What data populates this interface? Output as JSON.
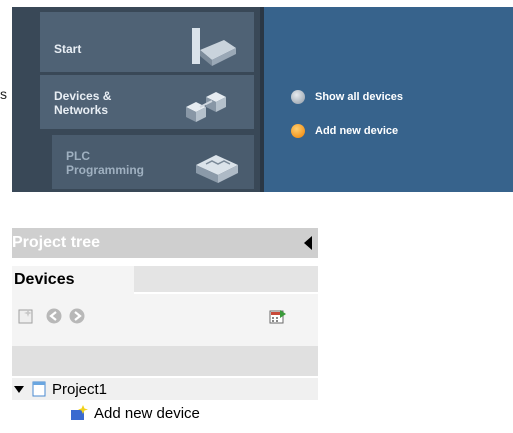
{
  "portal": {
    "nav": {
      "start_label": "Start",
      "devices_label": "Devices & Networks",
      "plc_label": "PLC Programming"
    },
    "actions": {
      "show_all": "Show all devices",
      "add_new": "Add new device"
    },
    "orphan_text": "s",
    "colors": {
      "accent": "#f08000",
      "right_panel": "#37638c",
      "left_panel": "#394857"
    }
  },
  "tree": {
    "title": "Project tree",
    "tab_label": "Devices",
    "project_label": "Project1",
    "add_device_label": "Add new device",
    "icons": [
      "new-project-icon",
      "back-icon",
      "forward-icon",
      "view-icon",
      "project-icon",
      "add-device-icon",
      "collapse-icon"
    ]
  }
}
